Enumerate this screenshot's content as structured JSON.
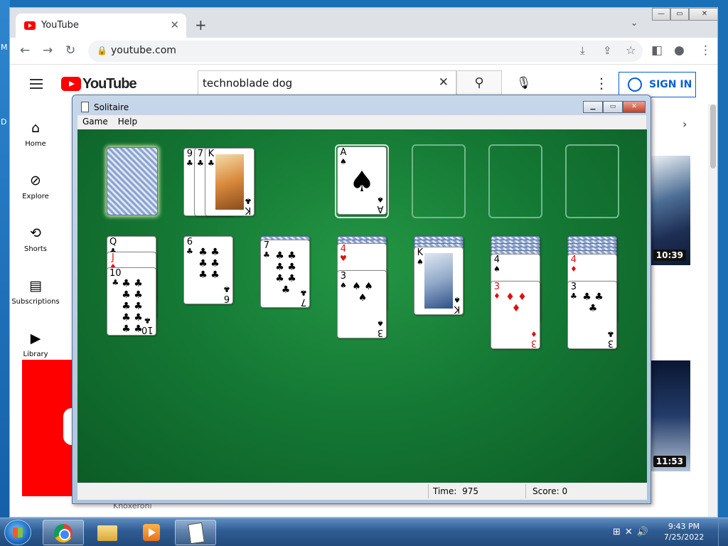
{
  "browser": {
    "tab_title": "YouTube",
    "tab_close": "✕",
    "new_tab": "+",
    "url": "youtube.com"
  },
  "youtube": {
    "logo_text": "YouTube",
    "search_query": "technoblade dog",
    "sign_in": "SIGN IN",
    "nav": [
      {
        "label": "Home",
        "icon": "home-icon",
        "glyph": "⌂"
      },
      {
        "label": "Explore",
        "icon": "compass-icon",
        "glyph": "⊘"
      },
      {
        "label": "Shorts",
        "icon": "shorts-icon",
        "glyph": "⟲"
      },
      {
        "label": "Subscriptions",
        "icon": "subscriptions-icon",
        "glyph": "▤"
      },
      {
        "label": "Library",
        "icon": "library-icon",
        "glyph": "▶"
      }
    ],
    "durations": [
      "10:39",
      "11:53"
    ],
    "below_text": "Knoxeroni"
  },
  "solitaire": {
    "title": "Solitaire",
    "menu": [
      "Game",
      "Help"
    ],
    "time_label": "Time:",
    "time_value": "975",
    "score_label": "Score:",
    "score_value": "0",
    "waste": [
      {
        "rank": "9",
        "suit": "♣"
      },
      {
        "rank": "7",
        "suit": "♣"
      },
      {
        "rank": "K",
        "suit": "♣"
      }
    ],
    "foundation_top": {
      "rank": "A",
      "suit": "♠"
    },
    "tableau": [
      {
        "hidden": 0,
        "up": [
          {
            "rank": "Q",
            "suit": "♣"
          },
          {
            "rank": "J",
            "suit": "♦"
          },
          {
            "rank": "10",
            "suit": "♣"
          }
        ]
      },
      {
        "hidden": 0,
        "up": [
          {
            "rank": "6",
            "suit": "♣"
          }
        ]
      },
      {
        "hidden": 1,
        "up": [
          {
            "rank": "7",
            "suit": "♣"
          }
        ]
      },
      {
        "hidden": 2,
        "up": [
          {
            "rank": "4",
            "suit": "♥"
          },
          {
            "rank": "3",
            "suit": "♠"
          }
        ]
      },
      {
        "hidden": 3,
        "up": [
          {
            "rank": "K",
            "suit": "♠"
          }
        ]
      },
      {
        "hidden": 5,
        "up": [
          {
            "rank": "4",
            "suit": "♠"
          },
          {
            "rank": "3",
            "suit": "♦"
          }
        ]
      },
      {
        "hidden": 5,
        "up": [
          {
            "rank": "4",
            "suit": "♦"
          },
          {
            "rank": "3",
            "suit": "♣"
          }
        ]
      }
    ]
  },
  "taskbar": {
    "time": "9:43 PM",
    "date": "7/25/2022"
  },
  "colors": {
    "felt": "#157a35",
    "youtube_red": "#ff0000",
    "link_blue": "#065fd4"
  }
}
